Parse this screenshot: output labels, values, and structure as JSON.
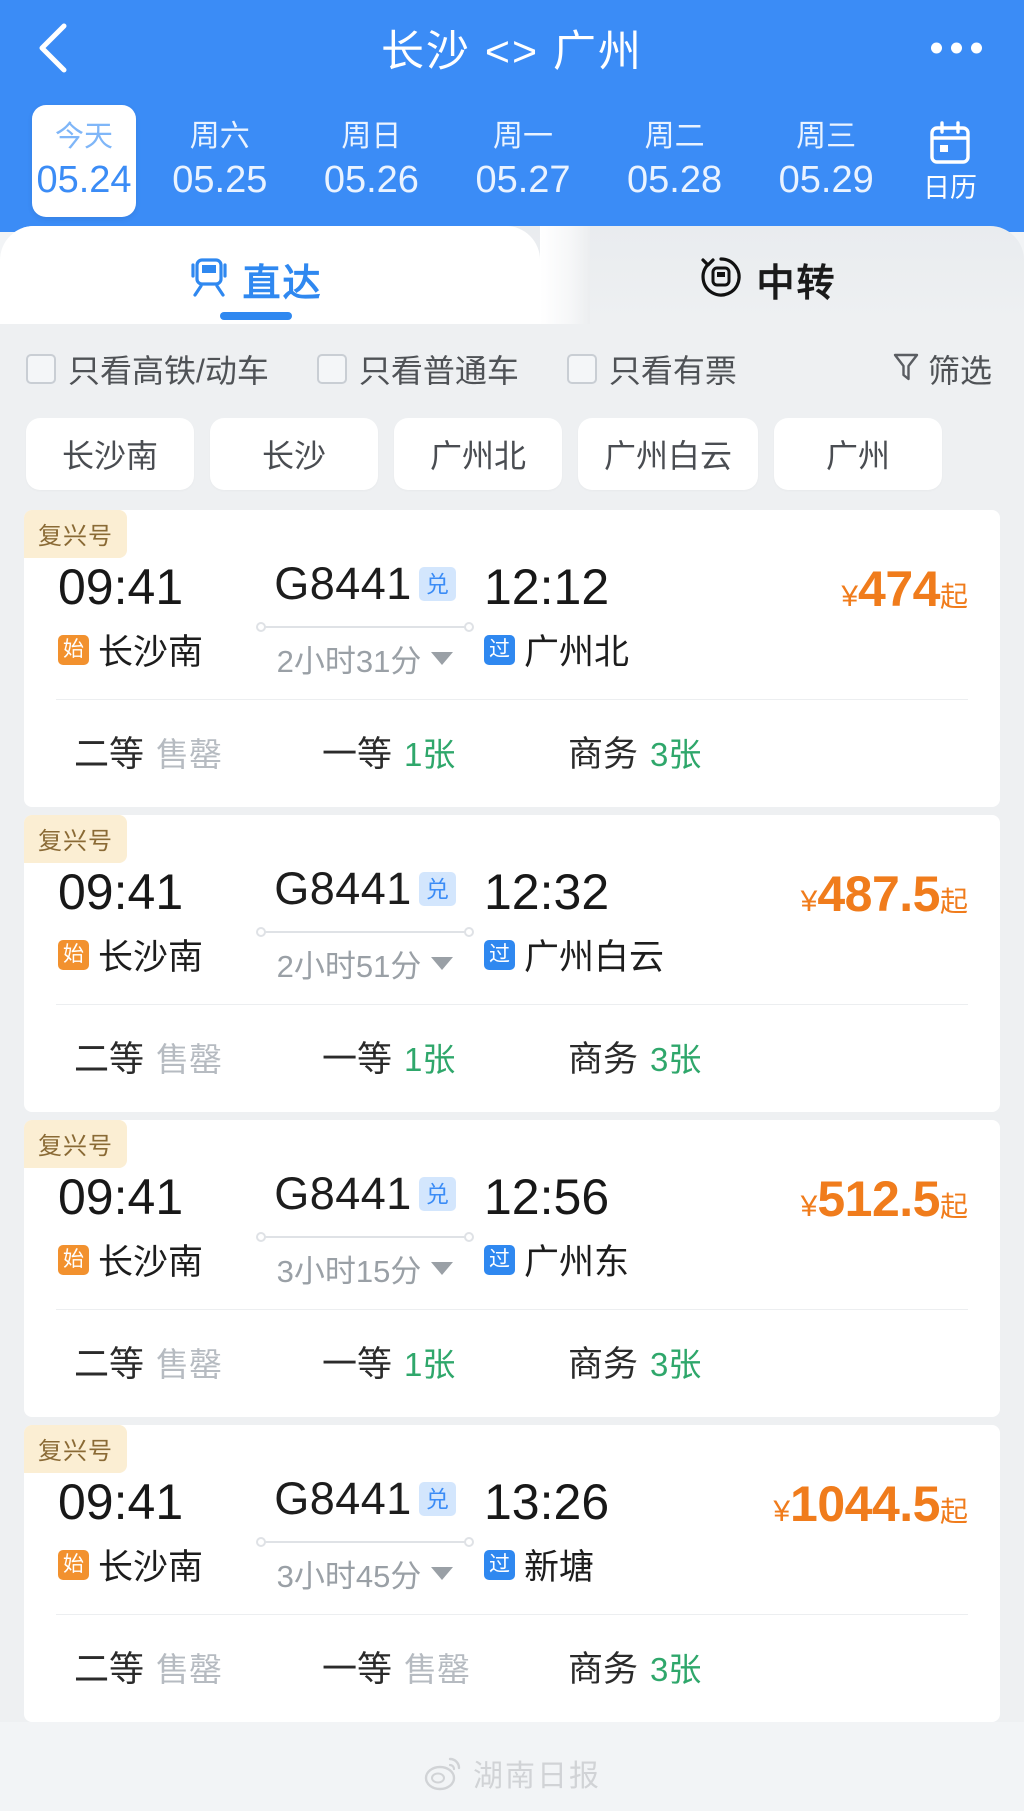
{
  "header": {
    "title": "长沙 <> 广州",
    "back_icon": "chevron-left-icon",
    "more_icon": "more-horizontal-icon",
    "dates": [
      {
        "dow": "今天",
        "date": "05.24",
        "active": true
      },
      {
        "dow": "周六",
        "date": "05.25",
        "active": false
      },
      {
        "dow": "周日",
        "date": "05.26",
        "active": false
      },
      {
        "dow": "周一",
        "date": "05.27",
        "active": false
      },
      {
        "dow": "周二",
        "date": "05.28",
        "active": false
      },
      {
        "dow": "周三",
        "date": "05.29",
        "active": false
      }
    ],
    "calendar": {
      "label": "日历",
      "icon": "calendar-icon"
    }
  },
  "tabs": [
    {
      "label": "直达",
      "icon": "train-icon",
      "active": true
    },
    {
      "label": "中转",
      "icon": "transfer-train-icon",
      "active": false
    }
  ],
  "filters": {
    "checkboxes": [
      {
        "label": "只看高铁/动车",
        "checked": false
      },
      {
        "label": "只看普通车",
        "checked": false
      },
      {
        "label": "只看有票",
        "checked": false
      }
    ],
    "filter_button": {
      "label": "筛选",
      "icon": "funnel-icon"
    }
  },
  "station_chips": [
    "长沙南",
    "长沙",
    "广州北",
    "广州白云",
    "广州"
  ],
  "trains": [
    {
      "tag": "复兴号",
      "depart_time": "09:41",
      "depart_badge": "始",
      "depart_station": "长沙南",
      "train_no": "G8441",
      "train_badge": "兑",
      "duration": "2小时31分",
      "arrive_time": "12:12",
      "arrive_badge": "过",
      "arrive_station": "广州北",
      "price_currency": "¥",
      "price": "474",
      "price_suffix": "起",
      "seats": [
        {
          "name": "二等",
          "value": "售罄",
          "available": false
        },
        {
          "name": "一等",
          "value": "1张",
          "available": true
        },
        {
          "name": "商务",
          "value": "3张",
          "available": true
        }
      ]
    },
    {
      "tag": "复兴号",
      "depart_time": "09:41",
      "depart_badge": "始",
      "depart_station": "长沙南",
      "train_no": "G8441",
      "train_badge": "兑",
      "duration": "2小时51分",
      "arrive_time": "12:32",
      "arrive_badge": "过",
      "arrive_station": "广州白云",
      "price_currency": "¥",
      "price": "487.5",
      "price_suffix": "起",
      "seats": [
        {
          "name": "二等",
          "value": "售罄",
          "available": false
        },
        {
          "name": "一等",
          "value": "1张",
          "available": true
        },
        {
          "name": "商务",
          "value": "3张",
          "available": true
        }
      ]
    },
    {
      "tag": "复兴号",
      "depart_time": "09:41",
      "depart_badge": "始",
      "depart_station": "长沙南",
      "train_no": "G8441",
      "train_badge": "兑",
      "duration": "3小时15分",
      "arrive_time": "12:56",
      "arrive_badge": "过",
      "arrive_station": "广州东",
      "price_currency": "¥",
      "price": "512.5",
      "price_suffix": "起",
      "seats": [
        {
          "name": "二等",
          "value": "售罄",
          "available": false
        },
        {
          "name": "一等",
          "value": "1张",
          "available": true
        },
        {
          "name": "商务",
          "value": "3张",
          "available": true
        }
      ]
    },
    {
      "tag": "复兴号",
      "depart_time": "09:41",
      "depart_badge": "始",
      "depart_station": "长沙南",
      "train_no": "G8441",
      "train_badge": "兑",
      "duration": "3小时45分",
      "arrive_time": "13:26",
      "arrive_badge": "过",
      "arrive_station": "新塘",
      "price_currency": "¥",
      "price": "1044.5",
      "price_suffix": "起",
      "seats": [
        {
          "name": "二等",
          "value": "售罄",
          "available": false
        },
        {
          "name": "一等",
          "value": "售罄",
          "available": false
        },
        {
          "name": "商务",
          "value": "3张",
          "available": true
        }
      ]
    }
  ],
  "watermark": {
    "text": "湖南日报",
    "icon": "weibo-icon"
  },
  "colors": {
    "brand_blue": "#3b8cf6",
    "accent_orange": "#f07c1c",
    "available_green": "#2fa76b",
    "soldout_grey": "#b6bbc1",
    "tag_bg": "#fbeed3"
  }
}
